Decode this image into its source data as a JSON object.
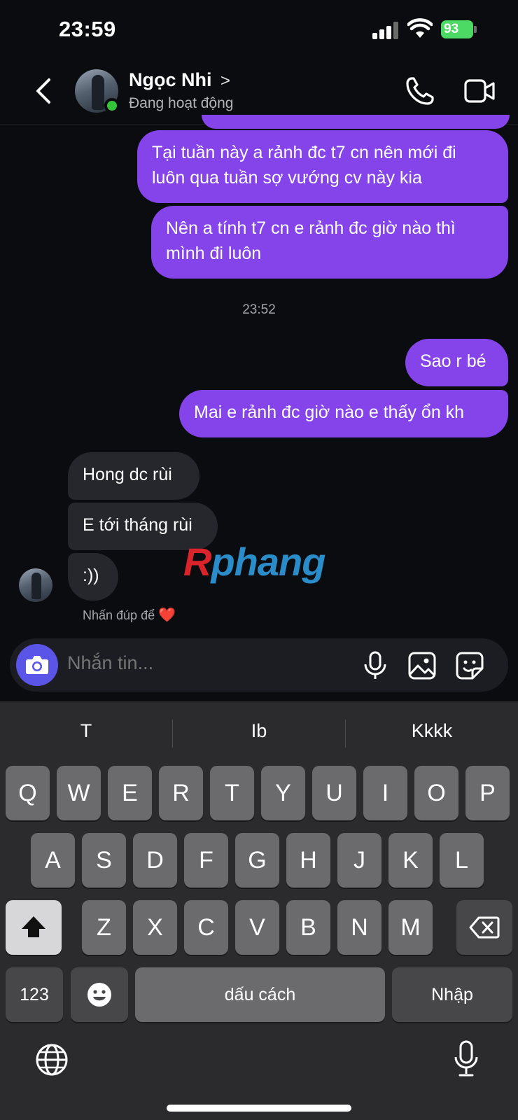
{
  "status_bar": {
    "time": "23:59",
    "battery": "93"
  },
  "header": {
    "contact_name": "Ngọc Nhi",
    "name_chevron": ">",
    "status": "Đang hoạt động"
  },
  "messages": [
    {
      "direction": "out",
      "text_lines": [
        "Tại tuần này a rảnh đc t7 cn nên mới đi",
        "luôn qua tuần sợ vướng cv này kia"
      ]
    },
    {
      "direction": "out",
      "text_lines": [
        "Nên a tính t7 cn e rảnh đc giờ nào thì",
        "mình đi luôn"
      ]
    },
    {
      "direction": "out",
      "text": "Sao r bé"
    },
    {
      "direction": "out",
      "text": "Mai e rảnh đc giờ nào e thấy ổn kh"
    },
    {
      "direction": "in",
      "text": "Hong dc rùi"
    },
    {
      "direction": "in",
      "text": "E tới tháng rùi"
    },
    {
      "direction": "in",
      "text": ":))"
    }
  ],
  "timestamp": "23:52",
  "reaction_hint": "Nhấn đúp để",
  "reaction_emoji": "❤️",
  "watermark": {
    "first": "R",
    "rest": "phang"
  },
  "composer": {
    "placeholder": "Nhắn tin..."
  },
  "keyboard": {
    "suggestions": [
      "T",
      "Ib",
      "Kkkk"
    ],
    "row1": [
      "Q",
      "W",
      "E",
      "R",
      "T",
      "Y",
      "U",
      "I",
      "O",
      "P"
    ],
    "row2": [
      "A",
      "S",
      "D",
      "F",
      "G",
      "H",
      "J",
      "K",
      "L"
    ],
    "row3": [
      "Z",
      "X",
      "C",
      "V",
      "B",
      "N",
      "M"
    ],
    "numbers_key": "123",
    "space_key": "dấu cách",
    "return_key": "Nhập"
  },
  "colors": {
    "outgoing_bubble": "#8544ea",
    "incoming_bubble": "#26272c",
    "online_dot": "#35c53a",
    "camera_button": "#5a55e6",
    "battery": "#4cd964"
  }
}
